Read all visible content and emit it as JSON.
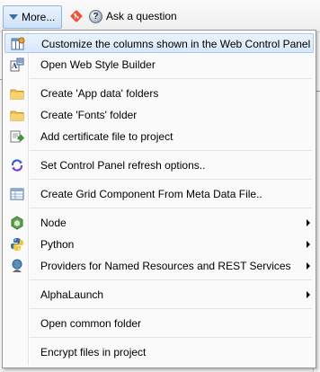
{
  "toolbar": {
    "more_label": "More...",
    "ask_label": "Ask a question"
  },
  "menu": {
    "items": [
      {
        "label": "Customize the columns shown in the Web Control Panel",
        "icon": "columns-settings-icon",
        "highlighted": true
      },
      {
        "label": "Open Web Style Builder",
        "icon": "style-builder-icon"
      },
      {
        "label": "Create 'App data' folders",
        "icon": "folder-icon"
      },
      {
        "label": "Create 'Fonts' folder",
        "icon": "folder-icon"
      },
      {
        "label": "Add certificate file to project",
        "icon": "certificate-add-icon"
      },
      {
        "label": "Set Control Panel refresh options..",
        "icon": "refresh-icon"
      },
      {
        "label": "Create Grid Component From Meta Data File..",
        "icon": "grid-icon"
      },
      {
        "label": "Node",
        "icon": "nodejs-icon",
        "submenu": true
      },
      {
        "label": "Python",
        "icon": "python-icon",
        "submenu": true
      },
      {
        "label": "Providers for Named Resources and REST Services",
        "icon": "globe-person-icon",
        "submenu": true
      },
      {
        "label": "AlphaLaunch",
        "icon": "",
        "submenu": true
      },
      {
        "label": "Open common folder",
        "icon": ""
      },
      {
        "label": "Encrypt files in project",
        "icon": ""
      }
    ]
  },
  "colors": {
    "highlight_border": "#a8caf0",
    "highlight_fill": "#d7e8fb",
    "folder": "#f2c04d",
    "refresh": "#2f5fc6"
  }
}
